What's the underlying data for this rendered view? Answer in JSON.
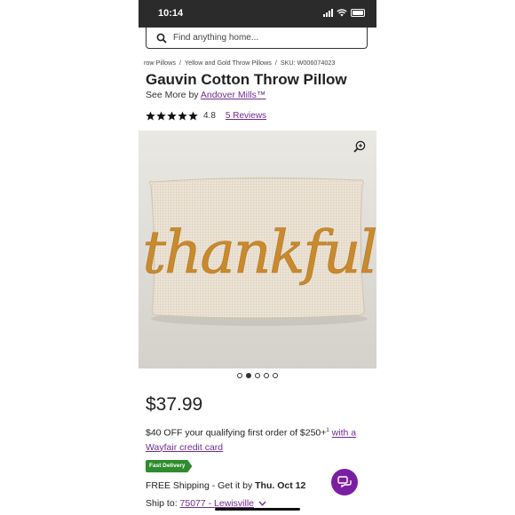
{
  "status_bar": {
    "time": "10:14"
  },
  "search": {
    "placeholder": "Find anything home..."
  },
  "breadcrumb": {
    "items": [
      "row Pillows",
      "Yellow and Gold Throw Pillows"
    ],
    "separator": "/",
    "sku": "SKU: W006074023"
  },
  "product": {
    "title": "Gauvin Cotton Throw Pillow",
    "see_more_prefix": "See More by ",
    "brand": "Andover Mills™",
    "rating": "4.8",
    "stars": 5,
    "reviews": "5 Reviews",
    "image_text": "thankful",
    "image_count": 5,
    "active_image": 2
  },
  "pricing": {
    "price": "$37.99",
    "promo_text": "$40 OFF your qualifying first order of $250+",
    "promo_sup": "1",
    "promo_link": "with a Wayfair credit card"
  },
  "delivery": {
    "badge": "Fast Delivery",
    "shipping_prefix": "FREE Shipping - Get it by ",
    "shipping_date": "Thu. Oct 12",
    "ship_to_label": "Ship to: ",
    "ship_to_location": "75077 - Lewisville"
  },
  "colors": {
    "accent": "#6f2c91",
    "chat_button": "#7b1fa2",
    "badge_green": "#2e8b2e",
    "pillow_fabric": "#e8dfd0",
    "pillow_lettering": "#c98a2e"
  },
  "icons": [
    "search-icon",
    "zoom-icon",
    "star-icon",
    "chevron-down-icon",
    "chat-icon",
    "signal-icon",
    "wifi-icon",
    "battery-icon"
  ]
}
